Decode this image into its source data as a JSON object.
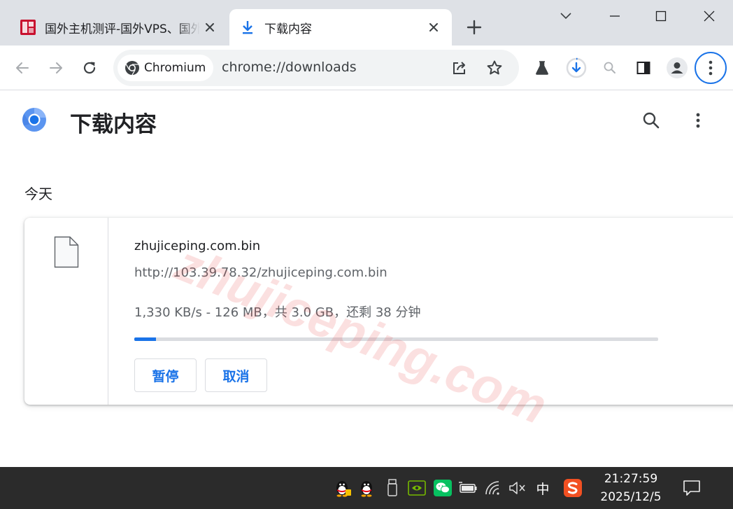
{
  "tabs": [
    {
      "title": "国外主机测评-国外VPS、国外服务器",
      "favicon": "site-seal-icon"
    },
    {
      "title": "下载内容",
      "favicon": "download-icon",
      "active": true
    }
  ],
  "toolbar": {
    "chip_label": "Chromium",
    "url": "chrome://downloads"
  },
  "page": {
    "title": "下载内容",
    "section_date": "今天"
  },
  "download": {
    "file_name": "zhujiceping.com.bin",
    "url": "http://103.39.78.32/zhujiceping.com.bin",
    "status": "1,330 KB/s - 126 MB，共 3.0 GB，还剩 38 分钟",
    "progress_fraction": 0.041,
    "pause_label": "暂停",
    "cancel_label": "取消"
  },
  "watermark": "zhujiceping.com",
  "taskbar": {
    "ime_label": "中",
    "time": "21:27:59",
    "date": "2025/12/5"
  },
  "colors": {
    "accent": "#1a73e8",
    "tabstrip": "#dee1e6",
    "taskbar": "#2b2b2b"
  }
}
